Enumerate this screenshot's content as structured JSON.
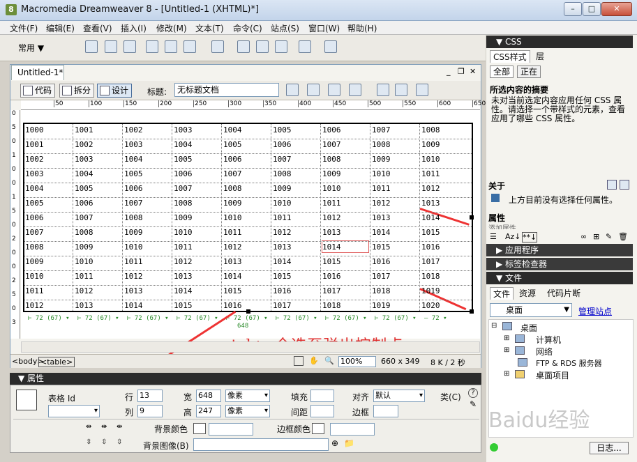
{
  "window": {
    "title": "Macromedia Dreamweaver 8 - [Untitled-1 (XHTML)*]"
  },
  "menubar": [
    "文件(F)",
    "编辑(E)",
    "查看(V)",
    "插入(I)",
    "修改(M)",
    "文本(T)",
    "命令(C)",
    "站点(S)",
    "窗口(W)",
    "帮助(H)"
  ],
  "toolbar": {
    "category": "常用"
  },
  "document": {
    "tab": "Untitled-1*",
    "views": [
      "代码",
      "拆分",
      "设计"
    ],
    "title_label": "标题:",
    "title_value": "无标题文档"
  },
  "ruler": {
    "h": [
      "50",
      "100",
      "150",
      "200",
      "250",
      "300",
      "350",
      "400",
      "450",
      "500",
      "550",
      "600",
      "650"
    ],
    "v": [
      "0",
      "5",
      "0",
      "1",
      "0",
      "0",
      "1",
      "5",
      "0",
      "2",
      "0",
      "0",
      "2",
      "5",
      "0",
      "3"
    ]
  },
  "table": {
    "rows": [
      [
        "1000",
        "1001",
        "1002",
        "1003",
        "1004",
        "1005",
        "1006",
        "1007",
        "1008"
      ],
      [
        "1001",
        "1002",
        "1003",
        "1004",
        "1005",
        "1006",
        "1007",
        "1008",
        "1009"
      ],
      [
        "1002",
        "1003",
        "1004",
        "1005",
        "1006",
        "1007",
        "1008",
        "1009",
        "1010"
      ],
      [
        "1003",
        "1004",
        "1005",
        "1006",
        "1007",
        "1008",
        "1009",
        "1010",
        "1011"
      ],
      [
        "1004",
        "1005",
        "1006",
        "1007",
        "1008",
        "1009",
        "1010",
        "1011",
        "1012"
      ],
      [
        "1005",
        "1006",
        "1007",
        "1008",
        "1009",
        "1010",
        "1011",
        "1012",
        "1013"
      ],
      [
        "1006",
        "1007",
        "1008",
        "1009",
        "1010",
        "1011",
        "1012",
        "1013",
        "1014"
      ],
      [
        "1007",
        "1008",
        "1009",
        "1010",
        "1011",
        "1012",
        "1013",
        "1014",
        "1015"
      ],
      [
        "1008",
        "1009",
        "1010",
        "1011",
        "1012",
        "1013",
        "1014",
        "1015",
        "1016"
      ],
      [
        "1009",
        "1010",
        "1011",
        "1012",
        "1013",
        "1014",
        "1015",
        "1016",
        "1017"
      ],
      [
        "1010",
        "1011",
        "1012",
        "1013",
        "1014",
        "1015",
        "1016",
        "1017",
        "1018"
      ],
      [
        "1011",
        "1012",
        "1013",
        "1014",
        "1015",
        "1016",
        "1017",
        "1018",
        "1019"
      ],
      [
        "1012",
        "1013",
        "1014",
        "1015",
        "1016",
        "1017",
        "1018",
        "1019",
        "1020"
      ]
    ],
    "col_width_label": "72 (67)",
    "last_col_width_label": "72",
    "table_width_label": "648"
  },
  "caption": "ctrl+a全选至弹出控制点",
  "statusbar": {
    "tags": [
      "<body>",
      "<table>"
    ],
    "zoom": "100%",
    "size": "660 x 349",
    "filesize": "8 K / 2 秒"
  },
  "properties": {
    "header": "属性",
    "table_id_label": "表格 Id",
    "rows_label": "行",
    "rows_value": "13",
    "cols_label": "列",
    "cols_value": "9",
    "width_label": "宽",
    "width_value": "648",
    "width_unit": "像素",
    "height_label": "高",
    "height_value": "247",
    "height_unit": "像素",
    "padding_label": "填充",
    "spacing_label": "间距",
    "align_label": "对齐",
    "align_value": "默认",
    "border_label": "边框",
    "class_label": "类(C)",
    "bgcolor_label": "背景颜色",
    "bordercolor_label": "边框颜色",
    "bgimage_label": "背景图像(B)"
  },
  "right": {
    "css_header": "CSS",
    "css_tabs": [
      "CSS样式",
      "层"
    ],
    "css_buttons": [
      "全部",
      "正在"
    ],
    "summary_title": "所选内容的摘要",
    "summary_text": "未对当前选定内容应用任何 CSS 属性。请选择一个带样式的元素，查看应用了哪些 CSS 属性。",
    "about_label": "关于",
    "about_text": "上方目前没有选择任何属性。",
    "props_label": "属性",
    "add_prop": "添加属性",
    "app_header": "应用程序",
    "tag_header": "标签检查器",
    "files_header": "文件",
    "files_tabs": [
      "文件",
      "资源",
      "代码片断"
    ],
    "site_select": "桌面",
    "manage_link": "管理站点",
    "tree": [
      "桌面",
      "计算机",
      "网络",
      "FTP & RDS 服务器",
      "桌面项目"
    ],
    "log_button": "日志..."
  },
  "watermark": "Baidu经验"
}
